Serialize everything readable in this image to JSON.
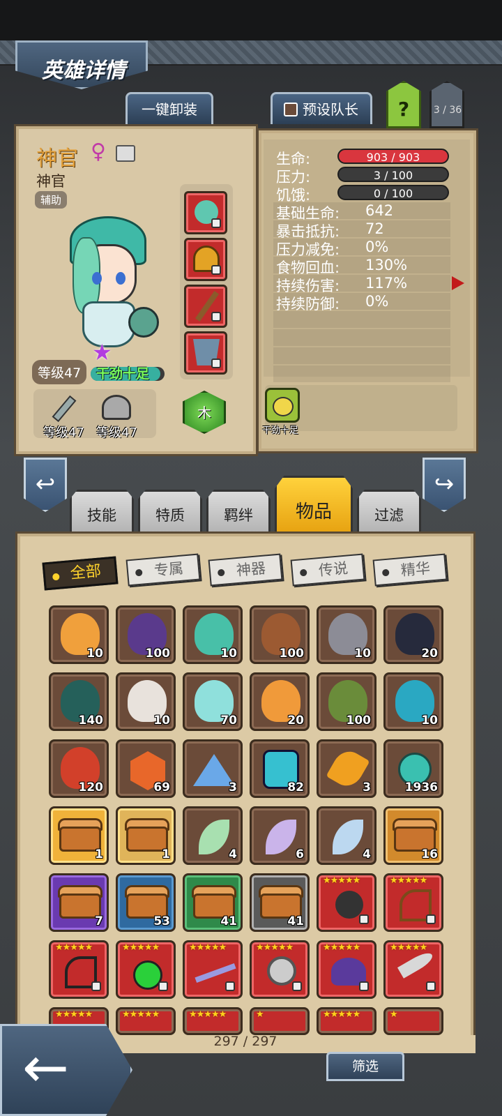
{
  "header": {
    "title": "英雄详情",
    "unequip_label": "一键卸装",
    "preset_leader_label": "预设队长",
    "help_label": "?",
    "page_counter": "3 / 36"
  },
  "hero": {
    "name": "神官",
    "class_name": "神官",
    "role_tag": "辅助",
    "level": "等级47",
    "mood_label": "干劲十足",
    "element": "木",
    "weapon_level": "等级47",
    "armor_level": "等级47",
    "trait_label": "干劲十足"
  },
  "stats": {
    "hp_label": "生命:",
    "hp_value": "903 / 903",
    "hp_fraction": 1.0,
    "stress_label": "压力:",
    "stress_value": "3 / 100",
    "stress_fraction": 0.03,
    "hunger_label": "饥饿:",
    "hunger_value": "0 / 100",
    "hunger_fraction": 0.0,
    "rows": [
      {
        "label": "基础生命:",
        "value": "642"
      },
      {
        "label": "暴击抵抗:",
        "value": "72"
      },
      {
        "label": "压力减免:",
        "value": "0%"
      },
      {
        "label": "食物回血:",
        "value": "130%"
      },
      {
        "label": "持续伤害:",
        "value": "117%"
      },
      {
        "label": "持续防御:",
        "value": "0%"
      }
    ]
  },
  "tabs": [
    "技能",
    "特质",
    "羁绊",
    "物品",
    "过滤"
  ],
  "active_tab": "物品",
  "filters": [
    "全部",
    "专属",
    "神器",
    "传说",
    "精华"
  ],
  "items_row1": [
    "10",
    "100",
    "10",
    "100",
    "10",
    "20"
  ],
  "items_row2": [
    "140",
    "10",
    "70",
    "20",
    "100",
    "10"
  ],
  "items_row3": [
    "120",
    "69",
    "3",
    "82",
    "3",
    "1936"
  ],
  "items_row4": [
    "1",
    "1",
    "4",
    "6",
    "4",
    "16"
  ],
  "items_row5": [
    "7",
    "53",
    "41",
    "41"
  ],
  "inventory_count": "297 / 297",
  "sort_label": "筛选",
  "colors": {
    "accent_green": "#8cc63f",
    "hp_red": "#d9363e",
    "panel_tan": "#d9c8a6",
    "item_red": "#c22b2b"
  }
}
